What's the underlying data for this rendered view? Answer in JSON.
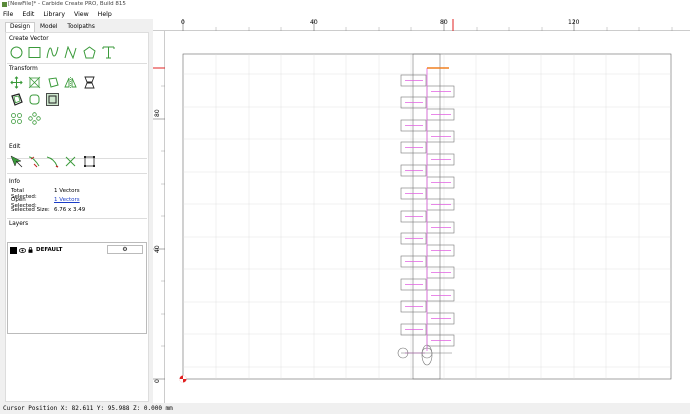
{
  "window": {
    "title": "[NewFile]* - Carbide Create PRO, Build 815"
  },
  "menu": [
    "File",
    "Edit",
    "Library",
    "View",
    "Help"
  ],
  "tabs": [
    "Design",
    "Model",
    "Toolpaths"
  ],
  "sections": {
    "create_vector": "Create Vector",
    "transform": "Transform",
    "edit": "Edit",
    "info": "Info",
    "layers": "Layers"
  },
  "info": {
    "total_selected_label": "Total Selected:",
    "total_selected_value": "1 Vectors",
    "open_selected_label": "Open Selected:",
    "open_selected_value": "1 Vectors",
    "selected_size_label": "Selected Size:",
    "selected_size_value": "6.76 x 3.49"
  },
  "layers": [
    {
      "name": "DEFAULT",
      "color": "#000000"
    }
  ],
  "ruler": {
    "top_labels": [
      "0",
      "40",
      "80",
      "120"
    ],
    "left_labels": [
      "80",
      "40",
      "0"
    ]
  },
  "status": {
    "text": "Cursor Position X: 82.611 Y: 95.988 Z: 0.000 mm"
  },
  "colors": {
    "accent_green": "#3a9a3a",
    "toolpath_pink": "#e060e0",
    "origin_red": "#e02020",
    "marker_orange": "#f08020"
  }
}
